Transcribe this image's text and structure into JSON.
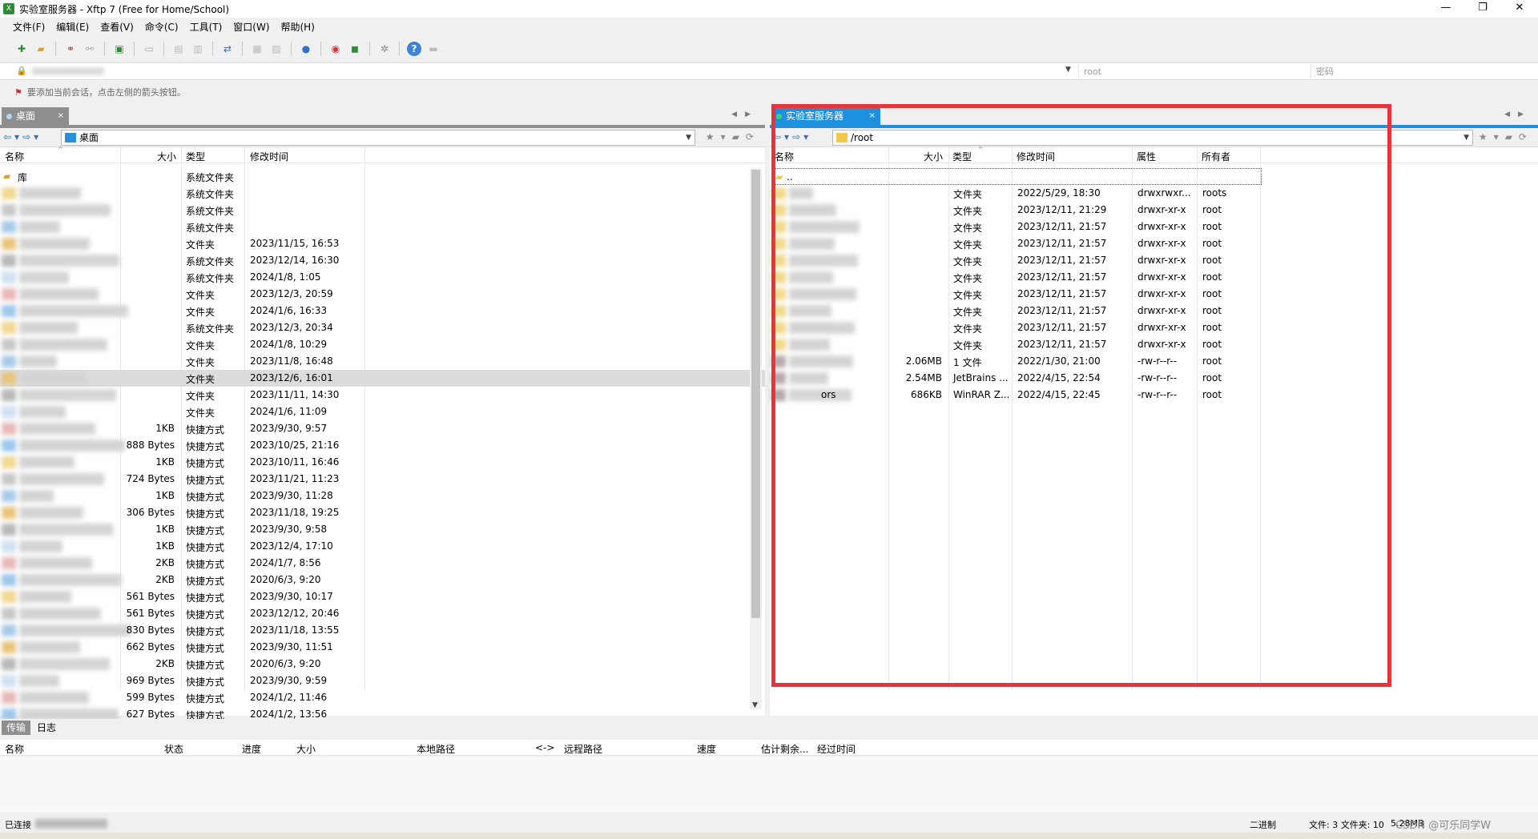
{
  "window": {
    "app_icon": "X",
    "title": "实验室服务器 - Xftp 7 (Free for Home/School)",
    "controls": [
      "—",
      "❐",
      "✕"
    ]
  },
  "menu": [
    "文件(F)",
    "编辑(E)",
    "查看(V)",
    "命令(C)",
    "工具(T)",
    "窗口(W)",
    "帮助(H)"
  ],
  "address": {
    "username_placeholder": "root",
    "password_placeholder": "密码"
  },
  "hint": "要添加当前会话，点击左侧的箭头按钮。",
  "left_panel": {
    "tab_label": "桌面",
    "path": "桌面",
    "columns": [
      "名称",
      "大小",
      "类型",
      "修改时间"
    ],
    "first_row_name": "库",
    "rows": [
      {
        "size": "",
        "type": "系统文件夹",
        "modified": ""
      },
      {
        "size": "",
        "type": "系统文件夹",
        "modified": ""
      },
      {
        "size": "",
        "type": "系统文件夹",
        "modified": ""
      },
      {
        "size": "",
        "type": "系统文件夹",
        "modified": ""
      },
      {
        "size": "",
        "type": "文件夹",
        "modified": "2023/11/15, 16:53"
      },
      {
        "size": "",
        "type": "系统文件夹",
        "modified": "2023/12/14, 16:30"
      },
      {
        "size": "",
        "type": "系统文件夹",
        "modified": "2024/1/8, 1:05"
      },
      {
        "size": "",
        "type": "文件夹",
        "modified": "2023/12/3, 20:59"
      },
      {
        "size": "",
        "type": "文件夹",
        "modified": "2024/1/6, 16:33"
      },
      {
        "size": "",
        "type": "系统文件夹",
        "modified": "2023/12/3, 20:34"
      },
      {
        "size": "",
        "type": "文件夹",
        "modified": "2024/1/8, 10:29"
      },
      {
        "size": "",
        "type": "文件夹",
        "modified": "2023/11/8, 16:48"
      },
      {
        "size": "",
        "type": "文件夹",
        "modified": "2023/12/6, 16:01"
      },
      {
        "size": "",
        "type": "文件夹",
        "modified": "2023/11/11, 14:30"
      },
      {
        "size": "",
        "type": "文件夹",
        "modified": "2024/1/6, 11:09"
      },
      {
        "size": "1KB",
        "type": "快捷方式",
        "modified": "2023/9/30, 9:57"
      },
      {
        "size": "888 Bytes",
        "type": "快捷方式",
        "modified": "2023/10/25, 21:16"
      },
      {
        "size": "1KB",
        "type": "快捷方式",
        "modified": "2023/10/11, 16:46"
      },
      {
        "size": "724 Bytes",
        "type": "快捷方式",
        "modified": "2023/11/21, 11:23"
      },
      {
        "size": "1KB",
        "type": "快捷方式",
        "modified": "2023/9/30, 11:28"
      },
      {
        "size": "306 Bytes",
        "type": "快捷方式",
        "modified": "2023/11/18, 19:25"
      },
      {
        "size": "1KB",
        "type": "快捷方式",
        "modified": "2023/9/30, 9:58"
      },
      {
        "size": "1KB",
        "type": "快捷方式",
        "modified": "2023/12/4, 17:10"
      },
      {
        "size": "2KB",
        "type": "快捷方式",
        "modified": "2024/1/7, 8:56"
      },
      {
        "size": "2KB",
        "type": "快捷方式",
        "modified": "2020/6/3, 9:20"
      },
      {
        "size": "561 Bytes",
        "type": "快捷方式",
        "modified": "2023/9/30, 10:17"
      },
      {
        "size": "561 Bytes",
        "type": "快捷方式",
        "modified": "2023/12/12, 20:46"
      },
      {
        "size": "830 Bytes",
        "type": "快捷方式",
        "modified": "2023/11/18, 13:55"
      },
      {
        "size": "662 Bytes",
        "type": "快捷方式",
        "modified": "2023/9/30, 11:51"
      },
      {
        "size": "2KB",
        "type": "快捷方式",
        "modified": "2020/6/3, 9:20"
      },
      {
        "size": "969 Bytes",
        "type": "快捷方式",
        "modified": "2023/9/30, 9:59"
      },
      {
        "size": "599 Bytes",
        "type": "快捷方式",
        "modified": "2024/1/2, 11:46"
      },
      {
        "size": "627 Bytes",
        "type": "快捷方式",
        "modified": "2024/1/2, 13:56"
      }
    ]
  },
  "right_panel": {
    "tab_label": "实验室服务器",
    "path": "/root",
    "columns": [
      "名称",
      "大小",
      "类型",
      "修改时间",
      "属性",
      "所有者"
    ],
    "parent_row": "..",
    "rows": [
      {
        "name": "",
        "size": "",
        "type": "文件夹",
        "modified": "2022/5/29, 18:30",
        "attr": "drwxrwxr...",
        "owner": "roots"
      },
      {
        "name": "",
        "size": "",
        "type": "文件夹",
        "modified": "2023/12/11, 21:29",
        "attr": "drwxr-xr-x",
        "owner": "root"
      },
      {
        "name": "",
        "size": "",
        "type": "文件夹",
        "modified": "2023/12/11, 21:57",
        "attr": "drwxr-xr-x",
        "owner": "root"
      },
      {
        "name": "",
        "size": "",
        "type": "文件夹",
        "modified": "2023/12/11, 21:57",
        "attr": "drwxr-xr-x",
        "owner": "root"
      },
      {
        "name": "",
        "size": "",
        "type": "文件夹",
        "modified": "2023/12/11, 21:57",
        "attr": "drwxr-xr-x",
        "owner": "root"
      },
      {
        "name": "",
        "size": "",
        "type": "文件夹",
        "modified": "2023/12/11, 21:57",
        "attr": "drwxr-xr-x",
        "owner": "root"
      },
      {
        "name": "",
        "size": "",
        "type": "文件夹",
        "modified": "2023/12/11, 21:57",
        "attr": "drwxr-xr-x",
        "owner": "root"
      },
      {
        "name": "",
        "size": "",
        "type": "文件夹",
        "modified": "2023/12/11, 21:57",
        "attr": "drwxr-xr-x",
        "owner": "root"
      },
      {
        "name": "",
        "size": "",
        "type": "文件夹",
        "modified": "2023/12/11, 21:57",
        "attr": "drwxr-xr-x",
        "owner": "root"
      },
      {
        "name": "",
        "size": "",
        "type": "文件夹",
        "modified": "2023/12/11, 21:57",
        "attr": "drwxr-xr-x",
        "owner": "root"
      },
      {
        "name": "",
        "size": "2.06MB",
        "type": "1 文件",
        "modified": "2022/1/30, 21:00",
        "attr": "-rw-r--r--",
        "owner": "root"
      },
      {
        "name": "",
        "size": "2.54MB",
        "type": "JetBrains ...",
        "modified": "2022/4/15, 22:54",
        "attr": "-rw-r--r--",
        "owner": "root"
      },
      {
        "name": "ors",
        "size": "686KB",
        "type": "WinRAR Z...",
        "modified": "2022/4/15, 22:45",
        "attr": "-rw-r--r--",
        "owner": "root"
      }
    ]
  },
  "transfer": {
    "tabs": [
      "传输",
      "日志"
    ],
    "columns": [
      "名称",
      "状态",
      "进度",
      "大小",
      "本地路径",
      "<->",
      "远程路径",
      "速度",
      "估计剩余...",
      "经过时间"
    ]
  },
  "status": {
    "connected": "已连接",
    "mode": "二进制",
    "counts": "文件: 3 文件夹: 10",
    "size": "5.28MB",
    "watermark": "CSDN @可乐同学W"
  }
}
